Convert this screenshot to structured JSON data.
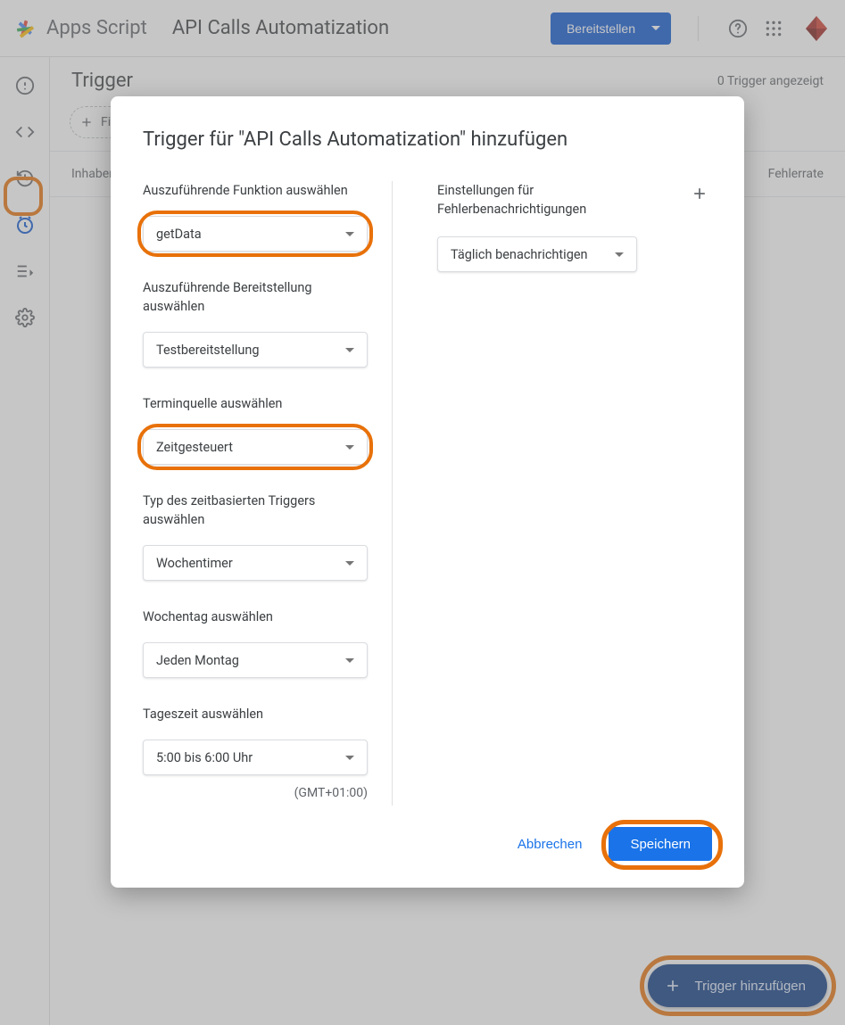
{
  "header": {
    "product": "Apps Script",
    "project_title": "API Calls Automatization",
    "deploy_label": "Bereitstellen"
  },
  "page": {
    "title": "Trigger",
    "count_text": "0 Trigger angezeigt",
    "filter_chip": "Filter hinzufügen",
    "col_owner": "Inhaber",
    "col_error_rate": "Fehlerrate",
    "fab_label": "Trigger hinzufügen"
  },
  "modal": {
    "title": "Trigger für \"API Calls Automatization\" hinzufügen",
    "left": {
      "function_label": "Auszuführende Funktion auswählen",
      "function_value": "getData",
      "deployment_label": "Auszuführende Bereitstellung auswählen",
      "deployment_value": "Testbereitstellung",
      "event_source_label": "Terminquelle auswählen",
      "event_source_value": "Zeitgesteuert",
      "timer_type_label": "Typ des zeitbasierten Triggers auswählen",
      "timer_type_value": "Wochentimer",
      "weekday_label": "Wochentag auswählen",
      "weekday_value": "Jeden Montag",
      "time_label": "Tageszeit auswählen",
      "time_value": "5:00 bis 6:00 Uhr",
      "timezone": "(GMT+01:00)"
    },
    "right": {
      "notify_label": "Einstellungen für Fehlerbenachrichtigungen",
      "notify_value": "Täglich benachrichtigen"
    },
    "cancel": "Abbrechen",
    "save": "Speichern"
  }
}
